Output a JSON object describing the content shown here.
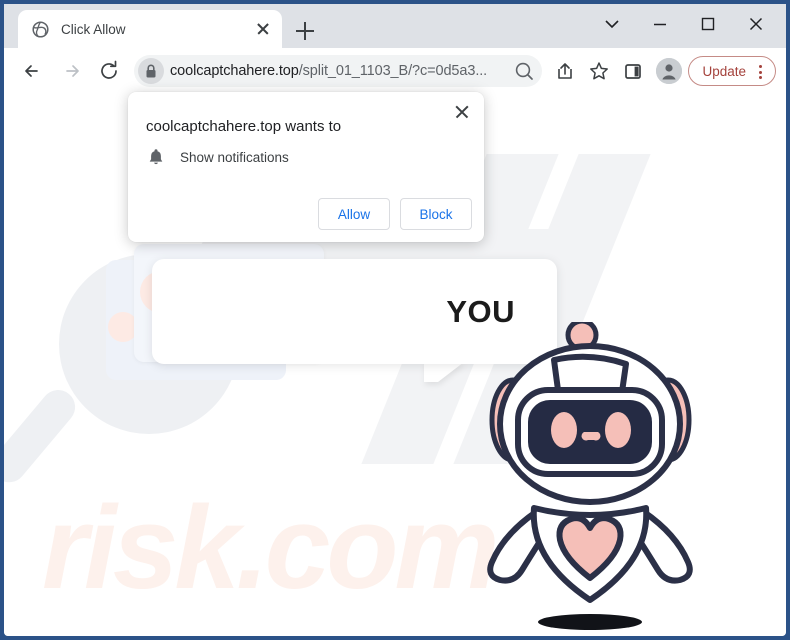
{
  "window": {
    "controls": {
      "tab_search": "tab-search-chevron",
      "minimize": "minimize",
      "maximize": "maximize",
      "close": "close"
    }
  },
  "tab": {
    "title": "Click Allow",
    "favicon": "globe-icon",
    "close_label": "close-tab",
    "new_tab_label": "new-tab"
  },
  "toolbar": {
    "back": "back-arrow-icon",
    "forward": "forward-arrow-icon",
    "reload": "reload-icon",
    "lock": "lock-icon",
    "url_domain": "coolcaptchahere.top",
    "url_path": "/split_01_1103_B/?c=0d5a3...",
    "url_full": "coolcaptchahere.top/split_01_1103_B/?c=0d5a3...",
    "zoom_icon": "search-zoom-icon",
    "share_icon": "share-icon",
    "bookmark_icon": "star-icon",
    "side_panel_icon": "side-panel-icon",
    "profile_icon": "profile-avatar-icon",
    "update_label": "Update",
    "update_menu": "three-dot-menu-icon",
    "update_color": "#a4423c"
  },
  "dialog": {
    "title": "coolcaptchahere.top wants to",
    "permission_icon": "bell-icon",
    "permission_label": "Show notifications",
    "allow_label": "Allow",
    "block_label": "Block",
    "close_label": "close-dialog",
    "button_color": "#1a73e8"
  },
  "page": {
    "speech_text": "YOU",
    "watermark_text": "risk.com",
    "watermark_color": "#fdf1ec",
    "robot": {
      "name": "robot-mascot",
      "outline_color": "#2b3047",
      "accent_color": "#f5bfb8",
      "face_color": "#252b44",
      "body_color": "#ffffff"
    }
  }
}
